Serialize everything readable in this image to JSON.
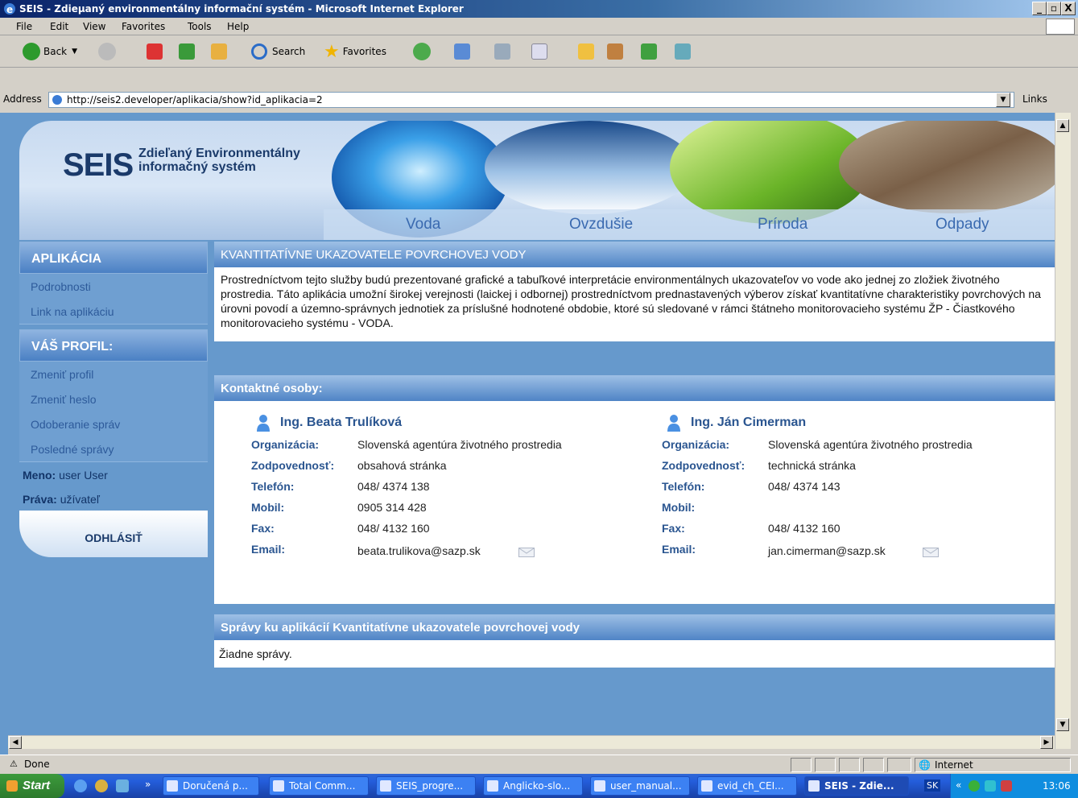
{
  "window": {
    "title": "SEIS - Zdieµaný environmentálny informační systém - Microsoft Internet Explorer",
    "min": "_",
    "max": "▫",
    "close": "X"
  },
  "menu": [
    "File",
    "Edit",
    "View",
    "Favorites",
    "Tools",
    "Help"
  ],
  "toolbar": {
    "back": "Back",
    "search": "Search",
    "favorites": "Favorites"
  },
  "address": {
    "label": "Address",
    "url": "http://seis2.developer/aplikacia/show?id_aplikacia=2",
    "links": "Links"
  },
  "banner": {
    "logo": "SEIS",
    "subtitle": "Zdieľaný Environmentálny\ninformačný systém",
    "categories": [
      "Voda",
      "Ovzdušie",
      "Príroda",
      "Odpady"
    ]
  },
  "sidebar": {
    "app_header": "APLIKÁCIA",
    "app_links": [
      "Podrobnosti",
      "Link na aplikáciu"
    ],
    "profile_header": "VÁŠ PROFIL:",
    "profile_links": [
      "Zmeniť profil",
      "Zmeniť heslo",
      "Odoberanie správ",
      "Posledné správy"
    ],
    "meno_label": "Meno:",
    "meno_value": " user User",
    "prava_label": "Práva:",
    "prava_value": " užívateľ",
    "logout": "ODHLÁSIŤ"
  },
  "main": {
    "title": "KVANTITATÍVNE UKAZOVATELE POVRCHOVEJ VODY",
    "description": "Prostredníctvom tejto služby budú prezentované grafické a tabuľkové interpretácie environmentálnych ukazovateľov vo vode ako jednej zo zložiek životného prostredia. Táto aplikácia umožní širokej verejnosti (laickej i odbornej) prostredníctvom prednastavených výberov získať kvantitatívne charakteristiky povrchových na úrovni povodí a územno-správnych jednotiek za príslušné hodnotené obdobie, ktoré sú sledované v rámci štátneho monitorovacieho systému ŽP - Čiastkového monitorovacieho systému - VODA.",
    "contacts_header": "Kontaktné osoby:",
    "labels": {
      "org": "Organizácia:",
      "resp": "Zodpovednosť:",
      "phone": "Telefón:",
      "mobile": "Mobil:",
      "fax": "Fax:",
      "email": "Email:"
    },
    "contacts": [
      {
        "name": "Ing. Beata Trulíková",
        "org": "Slovenská agentúra životného prostredia",
        "resp": "obsahová stránka",
        "phone": "048/ 4374 138",
        "mobile": "0905 314 428",
        "fax": "048/ 4132 160",
        "email": "beata.trulikova@sazp.sk"
      },
      {
        "name": "Ing. Ján Cimerman",
        "org": "Slovenská agentúra životného prostredia",
        "resp": "technická stránka",
        "phone": "048/ 4374 143",
        "mobile": "",
        "fax": "048/ 4132 160",
        "email": "jan.cimerman@sazp.sk"
      }
    ],
    "messages_header": "Správy ku aplikácií Kvantitatívne ukazovatele povrchovej vody",
    "messages_empty": "Žiadne správy."
  },
  "status": {
    "text": "Done",
    "zone": "Internet"
  },
  "taskbar": {
    "start": "Start",
    "tasks": [
      "Doručená p...",
      "Total Comm...",
      "SEIS_progre...",
      "Anglicko-slo...",
      "user_manual...",
      "evid_ch_CEI...",
      "SEIS - Zdie..."
    ],
    "lang": "SK",
    "time": "13:06"
  },
  "colors": {
    "page_bg": "#6699cc",
    "header_blue": "#4f84c6",
    "link": "#2d5a9a",
    "label": "#2a5590"
  }
}
